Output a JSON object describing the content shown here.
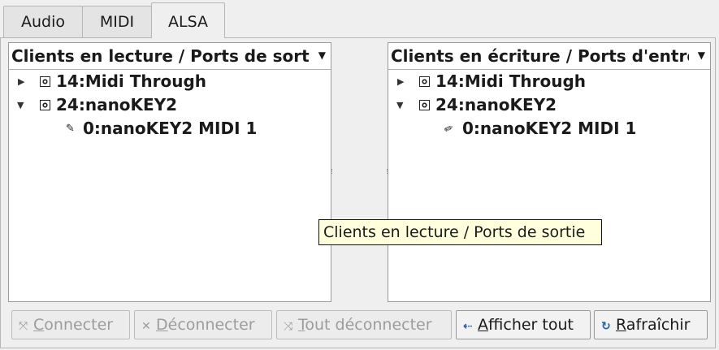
{
  "tabs": [
    {
      "label": "Audio"
    },
    {
      "label": "MIDI"
    },
    {
      "label": "ALSA"
    }
  ],
  "left_panel": {
    "header": "Clients en lecture / Ports de sortie",
    "items": [
      {
        "label": "14:Midi Through"
      },
      {
        "label": "24:nanoKEY2"
      },
      {
        "label": "0:nanoKEY2 MIDI 1"
      }
    ]
  },
  "right_panel": {
    "header": "Clients en écriture / Ports d'entrée",
    "items": [
      {
        "label": "14:Midi Through"
      },
      {
        "label": "24:nanoKEY2"
      },
      {
        "label": "0:nanoKEY2 MIDI 1"
      }
    ]
  },
  "tooltip": "Clients en lecture / Ports de sortie",
  "buttons": {
    "connect": {
      "first": "C",
      "rest": "onnecter"
    },
    "disconnect": {
      "first": "D",
      "rest": "éconnecter"
    },
    "disconnect_all": {
      "first": "T",
      "rest": "out déconnecter"
    },
    "show_all": {
      "first": "A",
      "rest": "fficher tout"
    },
    "refresh": {
      "first": "R",
      "rest": "afraîchir"
    }
  },
  "colors": {
    "accent": "#1f5faa",
    "tooltip_bg": "#ffffdc"
  }
}
